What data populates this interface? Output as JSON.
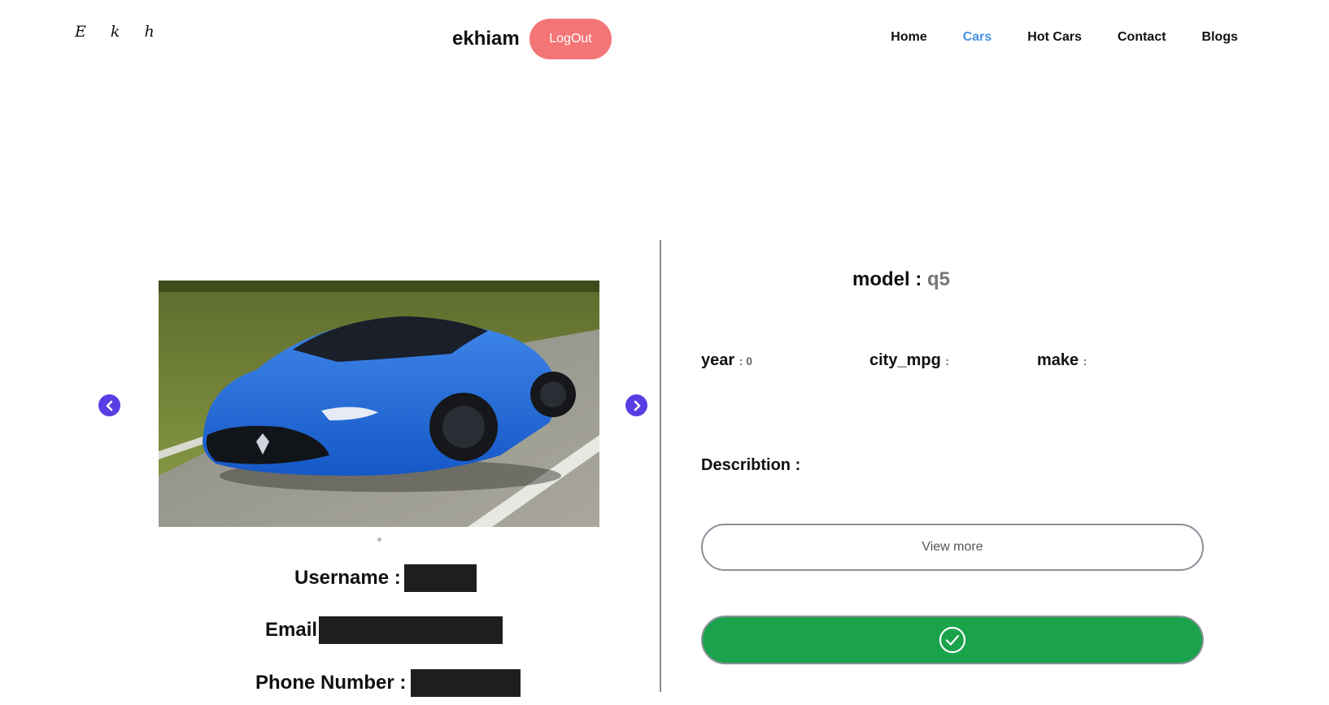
{
  "header": {
    "logo": "E k h",
    "username": "ekhiam",
    "logout_label": "LogOut"
  },
  "nav": {
    "items": [
      {
        "label": "Home",
        "active": false
      },
      {
        "label": "Cars",
        "active": true
      },
      {
        "label": "Hot Cars",
        "active": false
      },
      {
        "label": "Contact",
        "active": false
      },
      {
        "label": "Blogs",
        "active": false
      }
    ],
    "active_color": "#4a90e2"
  },
  "profile": {
    "username_label": "Username :",
    "email_label": "Email",
    "phone_label": "Phone Number :"
  },
  "car": {
    "model_label": "model :",
    "model_value": "q5",
    "year_label": "year",
    "year_value": ": 0",
    "city_mpg_label": "city_mpg",
    "city_mpg_value": ":",
    "make_label": "make",
    "make_value": ":",
    "description_label": "Describtion :"
  },
  "actions": {
    "view_more_label": "View more",
    "confirm_icon": "check-circle-icon"
  },
  "colors": {
    "logout_bg": "#f47575",
    "confirm_bg": "#1aa34a",
    "arrow_bg": "#5b3de6"
  }
}
